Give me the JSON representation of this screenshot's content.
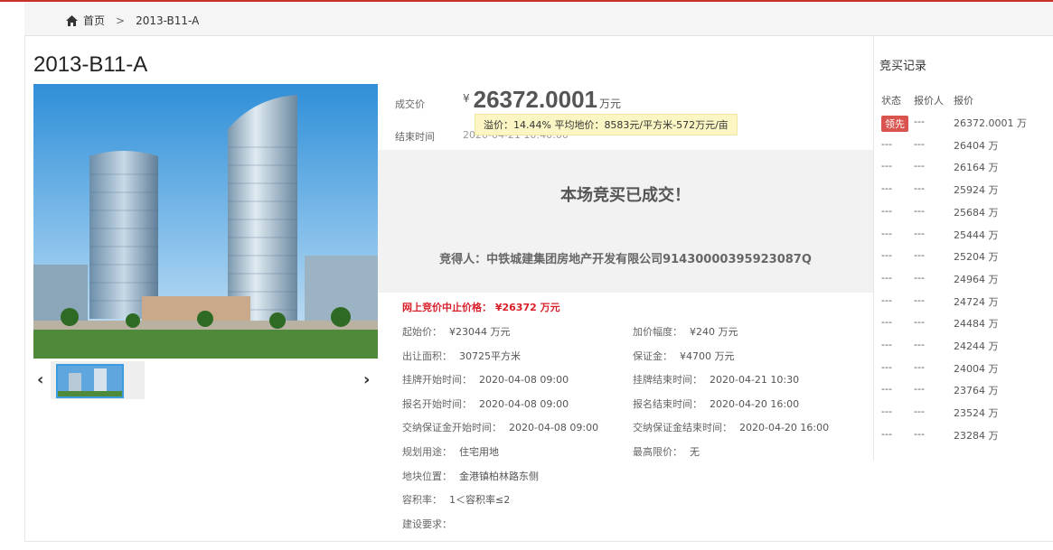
{
  "breadcrumb": {
    "home": "首页",
    "separator": ">",
    "current": "2013-B11-A"
  },
  "title": "2013-B11-A",
  "deal": {
    "label": "成交价",
    "currency": "¥",
    "value": "26372.0001",
    "unit": "万元",
    "premium_tip": "溢价：14.44%  平均地价：8583元/平方米-572万元/亩",
    "end_label": "结束时间",
    "end_value": "2020-04-21 10:40:00"
  },
  "result": {
    "headline": "本场竞买已成交！",
    "winner": "竞得人：中铁城建集团房地产开发有限公司91430000395923087Q"
  },
  "stop_price": "网上竞价中止价格： ¥26372 万元",
  "info": {
    "start_price": {
      "k": "起始价：",
      "v": "¥23044 万元"
    },
    "increment": {
      "k": "加价幅度：",
      "v": "¥240 万元"
    },
    "area": {
      "k": "出让面积：",
      "v": "30725平方米"
    },
    "deposit": {
      "k": "保证金：",
      "v": "¥4700 万元"
    },
    "list_start": {
      "k": "挂牌开始时间：",
      "v": "2020-04-08 09:00"
    },
    "list_end": {
      "k": "挂牌结束时间：",
      "v": "2020-04-21 10:30"
    },
    "reg_start": {
      "k": "报名开始时间：",
      "v": "2020-04-08 09:00"
    },
    "reg_end": {
      "k": "报名结束时间：",
      "v": "2020-04-20 16:00"
    },
    "dep_start": {
      "k": "交纳保证金开始时间：",
      "v": "2020-04-08 09:00"
    },
    "dep_end": {
      "k": "交纳保证金结束时间：",
      "v": "2020-04-20 16:00"
    },
    "usage": {
      "k": "规划用途：",
      "v": "住宅用地"
    },
    "limit": {
      "k": "最高限价：",
      "v": "无"
    },
    "location": {
      "k": "地块位置：",
      "v": "金港镇柏林路东侧"
    },
    "plot_ratio": {
      "k": "容积率：",
      "v": "1＜容积率≤2"
    },
    "requirements": {
      "k": "建设要求：",
      "v": ""
    }
  },
  "records": {
    "title": "竞买记录",
    "headers": [
      "状态",
      "报价人",
      "报价"
    ],
    "rows": [
      {
        "status": "领先",
        "bidder": "---",
        "price": "26372.0001 万"
      },
      {
        "status": "---",
        "bidder": "---",
        "price": "26404 万"
      },
      {
        "status": "---",
        "bidder": "---",
        "price": "26164 万"
      },
      {
        "status": "---",
        "bidder": "---",
        "price": "25924 万"
      },
      {
        "status": "---",
        "bidder": "---",
        "price": "25684 万"
      },
      {
        "status": "---",
        "bidder": "---",
        "price": "25444 万"
      },
      {
        "status": "---",
        "bidder": "---",
        "price": "25204 万"
      },
      {
        "status": "---",
        "bidder": "---",
        "price": "24964 万"
      },
      {
        "status": "---",
        "bidder": "---",
        "price": "24724 万"
      },
      {
        "status": "---",
        "bidder": "---",
        "price": "24484 万"
      },
      {
        "status": "---",
        "bidder": "---",
        "price": "24244 万"
      },
      {
        "status": "---",
        "bidder": "---",
        "price": "24004 万"
      },
      {
        "status": "---",
        "bidder": "---",
        "price": "23764 万"
      },
      {
        "status": "---",
        "bidder": "---",
        "price": "23524 万"
      },
      {
        "status": "---",
        "bidder": "---",
        "price": "23284 万"
      }
    ]
  },
  "colors": {
    "accent_red": "#d9202a",
    "badge_red": "#d9534f",
    "tip_bg": "#fcf6c4"
  },
  "icons": {
    "home": "home-icon",
    "prev": "chevron-left-icon",
    "next": "chevron-right-icon"
  },
  "gallery": {
    "prev_glyph": "‹",
    "next_glyph": "›"
  }
}
